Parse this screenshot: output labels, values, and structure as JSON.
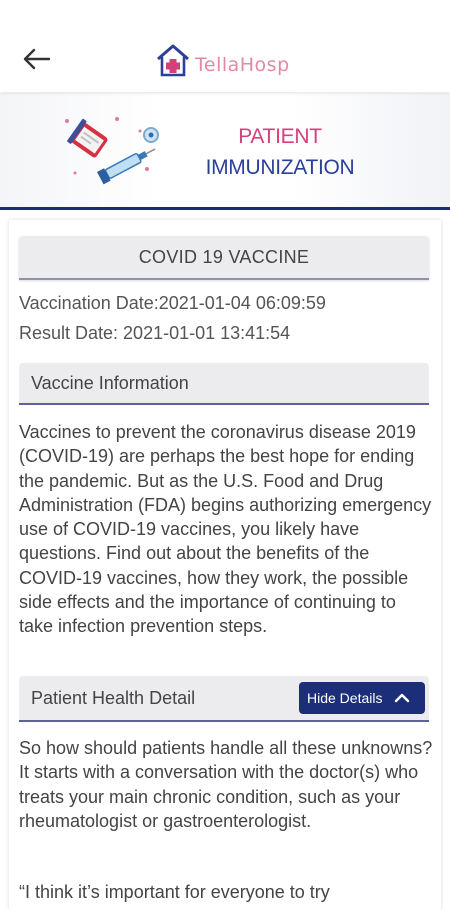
{
  "appbar": {
    "back_icon": "arrow-left-icon",
    "logo_text": "TellaHosp",
    "logo_icon": "house-medical-icon"
  },
  "banner": {
    "title_line1": "PATIENT",
    "title_line2": "IMMUNIZATION",
    "illustration_icon": "syringe-vial-icon"
  },
  "record": {
    "title": "COVID 19 VACCINE",
    "vaccination_date": "Vaccination Date:2021-01-04 06:09:59",
    "result_date": "Result Date: 2021-01-01 13:41:54"
  },
  "vaccine_info": {
    "heading": "Vaccine Information",
    "body": "Vaccines to prevent the coronavirus disease 2019 (COVID-19) are perhaps the best hope for ending the pandemic. But as the U.S. Food and Drug Administration (FDA) begins authorizing emergency use of COVID-19 vaccines, you likely have questions. Find out about the benefits of the COVID-19 vaccines, how they work, the possible side effects and the importance of continuing to take infection prevention steps."
  },
  "health_detail": {
    "heading": "Patient Health Detail",
    "toggle_label": "Hide Details",
    "toggle_icon": "chevron-up-icon",
    "body1": "So how should patients handle all these unknowns? It starts with a conversation with the doctor(s) who treats your main chronic condition, such as your rheumatologist or gastroenterologist.",
    "body2": "“I think it’s important for everyone to try"
  },
  "colors": {
    "brand_navy": "#1c2d7a",
    "brand_pink": "#d63f7a",
    "brand_blue": "#2c3f99"
  }
}
